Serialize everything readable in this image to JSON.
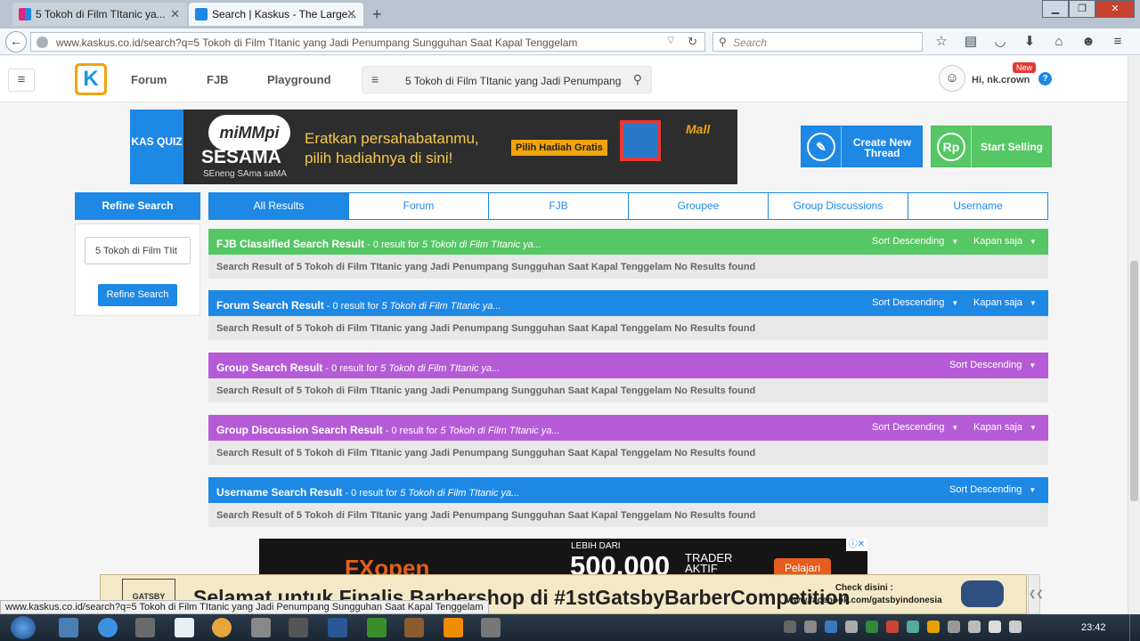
{
  "browser": {
    "tabs": [
      {
        "title": "5 Tokoh di Film TItanic ya..."
      },
      {
        "title": "Search | Kaskus - The Large..."
      }
    ],
    "url": "www.kaskus.co.id/search?q=5 Tokoh di Film TItanic yang Jadi Penumpang Sungguhan Saat Kapal Tenggelam",
    "search_placeholder": "Search",
    "status_url": "www.kaskus.co.id/search?q=5 Tokoh di Film TItanic yang Jadi Penumpang Sungguhan Saat Kapal Tenggelam"
  },
  "header": {
    "logo_letter": "K",
    "nav": [
      "Forum",
      "FJB",
      "Playground"
    ],
    "search_value": "5 Tokoh di Film TItanic yang Jadi Penumpang",
    "greeting": "Hi, nk.crown",
    "new_badge": "New",
    "help": "?"
  },
  "banner": {
    "kas_quiz": "KAS QUIZ",
    "mimmpi": "miMMpi",
    "sesama": "SESAMA",
    "sub": "SEneng SAma saMA",
    "message_line1": "Eratkan persahabatanmu,",
    "message_line2": "pilih hadiahnya di sini!",
    "button": "Pilih Hadiah Gratis",
    "mall": "Mall"
  },
  "actions": {
    "create_thread": "Create New Thread",
    "start_selling": "Start Selling",
    "rp": "Rp"
  },
  "refine": {
    "title": "Refine Search",
    "input_value": "5 Tokoh di Film TIit",
    "button": "Refine Search"
  },
  "tabs": [
    "All Results",
    "Forum",
    "FJB",
    "Groupee",
    "Group Discussions",
    "Username"
  ],
  "results": [
    {
      "title": "FJB Classified Search Result",
      "meta": " - 0 result for ",
      "query": "5 Tokoh di Film TItanic ya...",
      "sort": "Sort Descending",
      "time": "Kapan saja",
      "body": "Search Result of 5 Tokoh di Film TItanic yang Jadi Penumpang Sungguhan Saat Kapal Tenggelam No Results found"
    },
    {
      "title": "Forum Search Result",
      "meta": " - 0 result for ",
      "query": "5 Tokoh di Film TItanic ya...",
      "sort": "Sort Descending",
      "time": "Kapan saja",
      "body": "Search Result of 5 Tokoh di Film TItanic yang Jadi Penumpang Sungguhan Saat Kapal Tenggelam No Results found"
    },
    {
      "title": "Group Search Result",
      "meta": " - 0 result for ",
      "query": "5 Tokoh di Film TItanic ya...",
      "sort": "Sort Descending",
      "body": "Search Result of 5 Tokoh di Film TItanic yang Jadi Penumpang Sungguhan Saat Kapal Tenggelam No Results found"
    },
    {
      "title": "Group Discussion Search Result",
      "meta": " - 0 result for ",
      "query": "5 Tokoh di Film TItanic ya...",
      "sort": "Sort Descending",
      "time": "Kapan saja",
      "body": "Search Result of 5 Tokoh di Film TItanic yang Jadi Penumpang Sungguhan Saat Kapal Tenggelam No Results found"
    },
    {
      "title": "Username Search Result",
      "meta": " - 0 result for ",
      "query": "5 Tokoh di Film TItanic ya...",
      "sort": "Sort Descending",
      "body": "Search Result of 5 Tokoh di Film TItanic yang Jadi Penumpang Sungguhan Saat Kapal Tenggelam No Results found"
    }
  ],
  "ads": {
    "fx_logo": "FXopen",
    "lebih": "LEBIH DARI",
    "number": "500.000",
    "trader": "TRADER",
    "aktif": "AKTIF",
    "pelajari": "Pelajari",
    "gatsby": "GATSBY",
    "headline": "Selamat untuk Finalis Barbershop di #1stGatsbyBarberCompetition",
    "check1": "Check disini :",
    "check2": "www.facebook.com/gatsbyindonesia"
  },
  "taskbar": {
    "time": "23:42"
  },
  "colors": {
    "blue": "#1e88e5",
    "green": "#55c765",
    "purple": "#b65bd8",
    "orange": "#f1a40f"
  }
}
